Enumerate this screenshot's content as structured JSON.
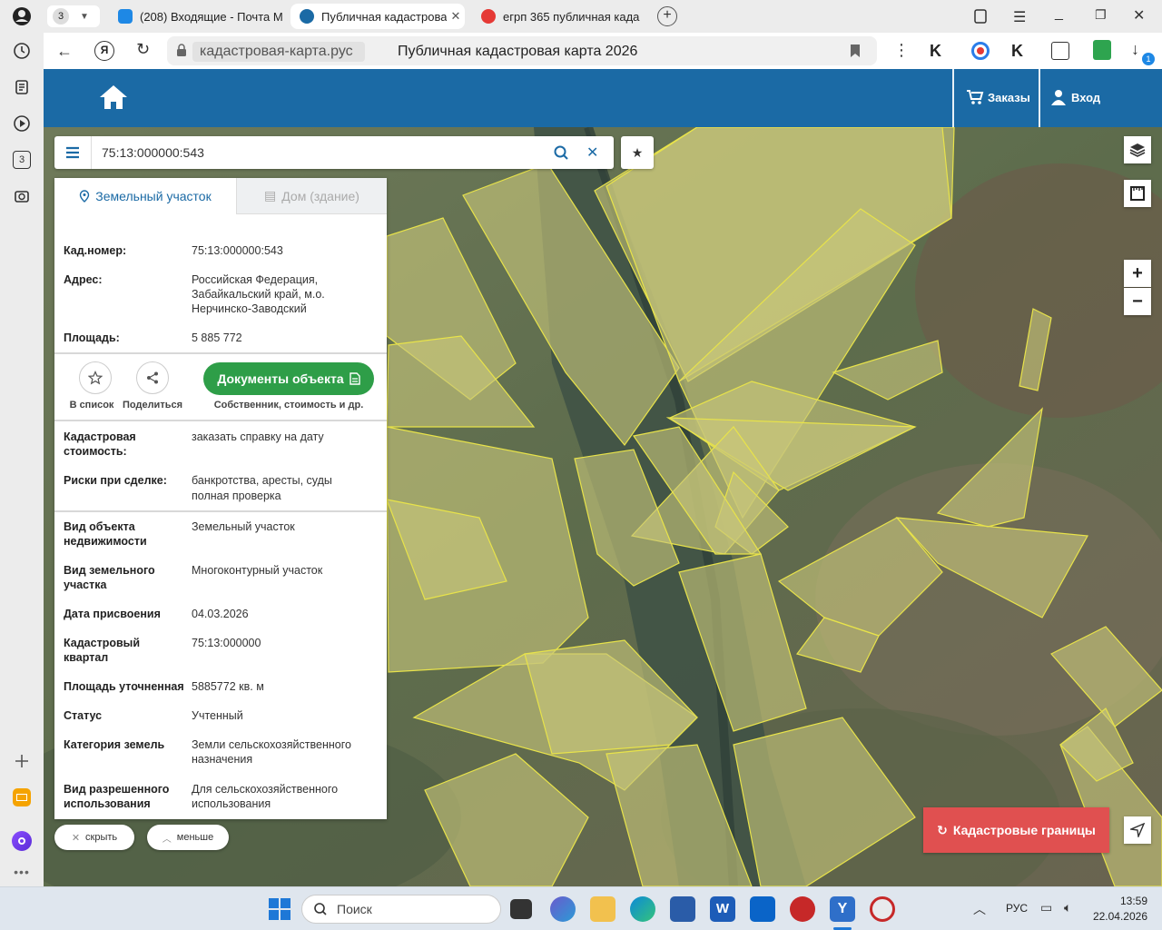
{
  "browser": {
    "tab_count": "3",
    "tabs": [
      {
        "label": "(208) Входящие - Почта М",
        "favicon_color": "#1e88e5"
      },
      {
        "label": "Публичная кадастрова",
        "favicon_color": "#1b6aa5"
      },
      {
        "label": "егрп 365 публичная када",
        "favicon_color": "#e53935"
      }
    ],
    "url": "кадастровая-карта.рус",
    "page_title": "Публичная кадастровая карта 2026",
    "downloads_badge": "1"
  },
  "site": {
    "orders_label": "Заказы",
    "login_label": "Вход",
    "brand_color": "#1b6aa5"
  },
  "search": {
    "value": "75:13:000000:543"
  },
  "panel": {
    "tab_land": "Земельный участок",
    "tab_house": "Дом (здание)",
    "cad_number_label": "Кад.номер:",
    "cad_number_value": "75:13:000000:543",
    "address_label": "Адрес:",
    "address_value": "Российская Федерация, Забайкальский край, м.о. Нерчинско-Заводский",
    "area_label": "Площадь:",
    "area_value": "5 885 772",
    "add_to_list": "В список",
    "share": "Поделиться",
    "documents_button": "Документы объекта",
    "documents_sub": "Собственник, стоимость и др.",
    "cad_cost_label": "Кадастровая стоимость:",
    "cad_cost_link": "заказать справку на дату",
    "risks_label": "Риски при сделке:",
    "risks_value": "банкротства, аресты, суды",
    "risks_link": "полная проверка",
    "details": [
      {
        "k": "Вид объекта недвижимости",
        "v": "Земельный участок"
      },
      {
        "k": "Вид земельного участка",
        "v": "Многоконтурный участок"
      },
      {
        "k": "Дата присвоения",
        "v": "04.03.2026"
      },
      {
        "k": "Кадастровый квартал",
        "v": "75:13:000000"
      },
      {
        "k": "Площадь уточненная",
        "v": "5885772 кв. м"
      },
      {
        "k": "Статус",
        "v": "Учтенный"
      },
      {
        "k": "Категория земель",
        "v": "Земли сельскохозяйственного назначения"
      },
      {
        "k": "Вид разрешенного использования",
        "v": "Для сельскохозяйственного использования"
      }
    ]
  },
  "map_controls": {
    "hide": "скрыть",
    "less": "меньше",
    "zoom_in": "+",
    "zoom_out": "−",
    "cadastral_button": "Кадастровые границы",
    "cadastral_color": "#e05050"
  },
  "taskbar": {
    "search_placeholder": "Поиск",
    "language": "РУС",
    "time": "13:59",
    "date": "22.04.2026"
  }
}
